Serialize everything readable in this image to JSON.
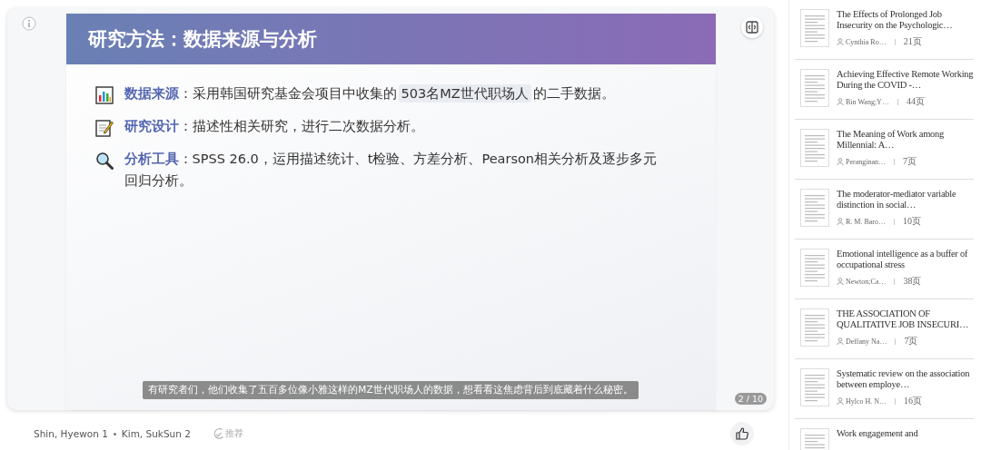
{
  "slide": {
    "title": "研究方法：数据来源与分析",
    "page": "2 / 10",
    "subtitle": "有研究者们，他们收集了五百多位像小雅这样的MZ世代职场人的数据，想看看这焦虑背后到底藏着什么秘密。",
    "bullets": [
      {
        "kind": "chart",
        "label": "数据来源",
        "segments": [
          {
            "kind": "plain",
            "text": "：采用韩国研究基金会项目中收集的"
          },
          {
            "kind": "highlight",
            "text": "503名MZ世代职场人"
          },
          {
            "kind": "plain",
            "text": "的二手数据。"
          }
        ]
      },
      {
        "kind": "memo",
        "label": "研究设计",
        "segments": [
          {
            "kind": "plain",
            "text": "：描述性相关研究，进行二次数据分析。"
          }
        ]
      },
      {
        "kind": "magnifier",
        "label": "分析工具",
        "segments": [
          {
            "kind": "plain",
            "text": "：SPSS 26.0，运用描述统计、t检验、方差分析、Pearson相关分析及逐步多元回归分析。"
          }
        ]
      }
    ]
  },
  "authors": [
    "Shin, Hyewon 1",
    "Kim, SukSun 2"
  ],
  "recommend": "推荐",
  "related": [
    {
      "title": "The Effects of Prolonged Job Insecurity on the Psychologic…",
      "author": "Cynthia Ro…",
      "pages": "21页"
    },
    {
      "title": "Achieving Effective Remote Working During the COVID -…",
      "author": "Bin Wang;Y…",
      "pages": "44页"
    },
    {
      "title": "The Meaning of Work among Millennial: A…",
      "author": "Peranginan…",
      "pages": "7页"
    },
    {
      "title": "The moderator-mediator variable distinction in social…",
      "author": "R. M. Baro…",
      "pages": "10页"
    },
    {
      "title": "Emotional intelligence as a buffer of occupational stress",
      "author": "Newton;Ca…",
      "pages": "38页"
    },
    {
      "title": "THE ASSOCIATION OF QUALITATIVE JOB INSECURI…",
      "author": "Deffany Na…",
      "pages": "7页"
    },
    {
      "title": "Systematic review on the association between employe…",
      "author": "Hylco H. N…",
      "pages": "16页"
    },
    {
      "title": "Work engagement and"
    }
  ]
}
